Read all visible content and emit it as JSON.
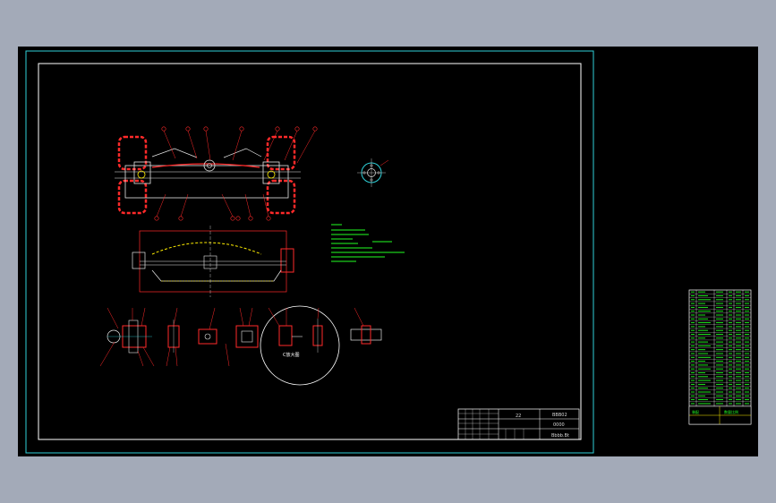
{
  "title_block": {
    "scale": "22",
    "drawing_no": "BBB02",
    "material": "0000",
    "part_name": "Bbbb.Bt"
  },
  "detail_view": {
    "label": "C放大图"
  },
  "bom_table": {
    "footer_left": "装配",
    "footer_right": "数量比例"
  },
  "colors": {
    "background": "#000000",
    "frame": "#2fd0d8",
    "border": "#ffffff",
    "outline": "#ff2a2a",
    "geometry": "#e6e6e6",
    "notes": "#22ff22",
    "yellow": "#ffee00",
    "outer_bg": "#a3aab8"
  }
}
